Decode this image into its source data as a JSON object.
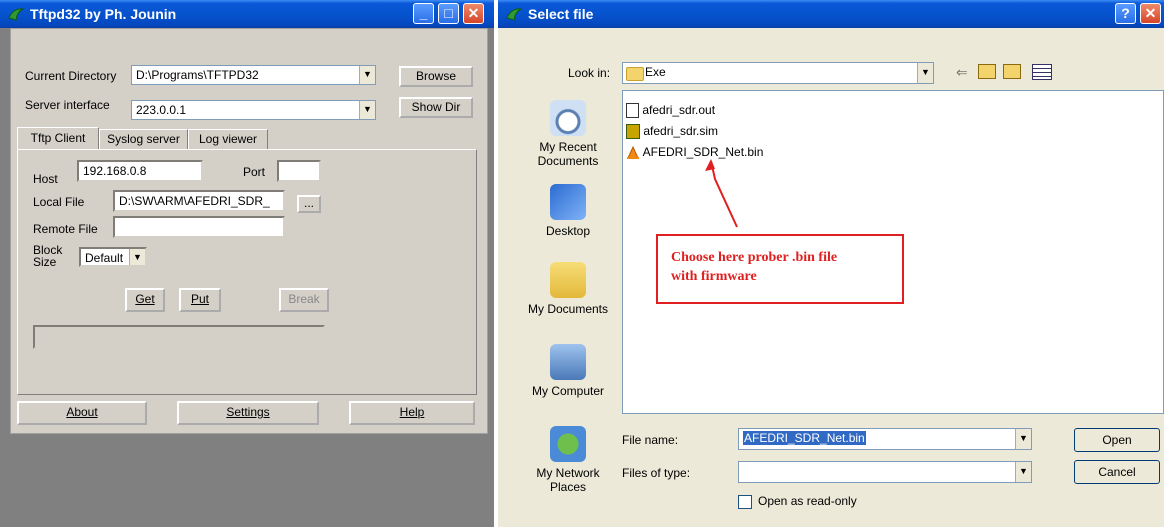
{
  "tftpd": {
    "title": "Tftpd32 by Ph. Jounin",
    "current_directory_label": "Current Directory",
    "current_directory_value": "D:\\Programs\\TFTPD32",
    "browse_button": "Browse",
    "server_interface_label": "Server interface",
    "server_interface_value": "223.0.0.1",
    "show_dir_button": "Show Dir",
    "tabs": [
      "Tftp Client",
      "Syslog server",
      "Log viewer"
    ],
    "host_label": "Host",
    "host_value": "192.168.0.8",
    "port_label": "Port",
    "port_value": "",
    "local_file_label": "Local File",
    "local_file_value": "D:\\SW\\ARM\\AFEDRI_SDR_",
    "ellipsis_button": "...",
    "remote_file_label": "Remote File",
    "remote_file_value": "",
    "block_size_label_1": "Block",
    "block_size_label_2": "Size",
    "block_size_value": "Default",
    "get_button": "Get",
    "put_button": "Put",
    "break_button": "Break",
    "about_button": "About",
    "settings_button": "Settings",
    "help_button": "Help"
  },
  "dialog": {
    "title": "Select file",
    "look_in_label": "Look in:",
    "look_in_value": "Exe",
    "places": [
      {
        "label_1": "My Recent",
        "label_2": "Documents"
      },
      {
        "label_1": "Desktop",
        "label_2": ""
      },
      {
        "label_1": "My Documents",
        "label_2": ""
      },
      {
        "label_1": "My Computer",
        "label_2": ""
      },
      {
        "label_1": "My Network",
        "label_2": "Places"
      }
    ],
    "files": [
      "afedri_sdr.out",
      "afedri_sdr.sim",
      "AFEDRI_SDR_Net.bin"
    ],
    "annotation_line_1": "Choose here prober .bin file",
    "annotation_line_2": "with firmware",
    "file_name_label": "File name:",
    "file_name_value": "AFEDRI_SDR_Net.bin",
    "files_of_type_label": "Files of type:",
    "files_of_type_value": "",
    "open_button": "Open",
    "cancel_button": "Cancel",
    "read_only_label": "Open as read-only"
  }
}
